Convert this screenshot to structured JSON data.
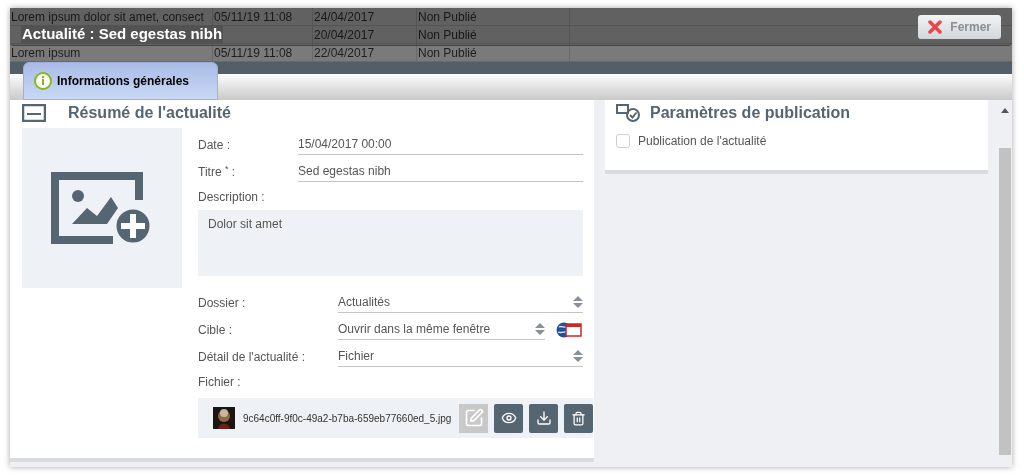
{
  "background_table": {
    "rows": [
      {
        "cells": [
          "Lorem ipsum dolor sit amet, consect",
          "05/11/19 11:08",
          "24/04/2017",
          "Non Publié"
        ],
        "selected": false
      },
      {
        "cells": [
          "20/04/2017",
          "Non Publié"
        ],
        "selected": false
      },
      {
        "cells": [
          "Lorem ipsum",
          "05/11/19 11:08",
          "22/04/2017",
          "Non Publié"
        ],
        "selected": false
      },
      {
        "selected": true
      }
    ]
  },
  "dialog": {
    "title": "Actualité : Sed egestas nibh",
    "close_button": "Fermer"
  },
  "tabs": [
    {
      "label": "Informations générales",
      "selected": true
    }
  ],
  "summary": {
    "heading": "Résumé de l'actualité",
    "top_fields": [
      {
        "kind": "text",
        "label": "Date :",
        "value": "15/04/2017 00:00"
      },
      {
        "kind": "text",
        "label": "Titre $^{*}$ :",
        "value": "Sed egestas nibh"
      }
    ],
    "description": {
      "label": "Description :",
      "value": "Dolor sit amet"
    },
    "select_fields": [
      {
        "kind": "select",
        "label": "Dossier :",
        "value": "Actualités"
      },
      {
        "kind": "select_with_icon",
        "label": "Cible :",
        "value": "Ouvrir dans la même fenêtre"
      },
      {
        "kind": "select",
        "label": "Détail de l'actualité :",
        "value": "Fichier"
      }
    ],
    "file": {
      "label": "Fichier :",
      "name": "9c64c0ff-9f0c-49a2-b7ba-659eb77660ed_5.jpg"
    }
  },
  "publication": {
    "heading": "Paramètres de publication",
    "checkbox": {
      "label": "Publication de l'actualité",
      "checked": false
    }
  }
}
